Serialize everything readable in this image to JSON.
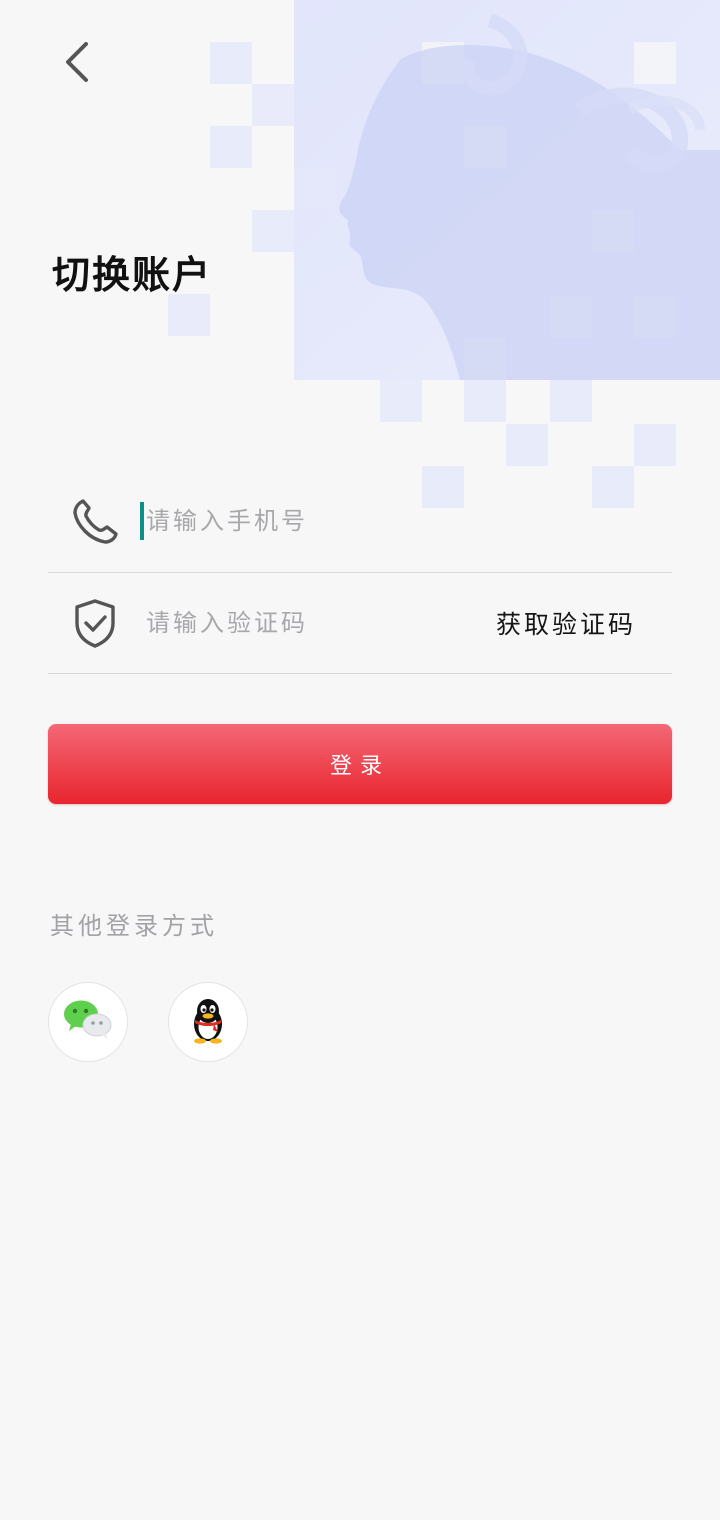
{
  "header": {
    "back_icon": "chevron-left-icon",
    "title": "切换账户"
  },
  "form": {
    "phone": {
      "icon": "phone-icon",
      "placeholder": "请输入手机号",
      "value": ""
    },
    "code": {
      "icon": "shield-check-icon",
      "placeholder": "请输入验证码",
      "value": "",
      "get_code_label": "获取验证码"
    },
    "login_label": "登录"
  },
  "other_login": {
    "label": "其他登录方式",
    "options": [
      {
        "name": "wechat",
        "icon": "wechat-icon"
      },
      {
        "name": "qq",
        "icon": "qq-icon"
      }
    ]
  },
  "colors": {
    "accent_red_top": "#f46876",
    "accent_red_bottom": "#e8252e",
    "cursor_teal": "#0c8f86",
    "background": "#f7f7f8"
  }
}
